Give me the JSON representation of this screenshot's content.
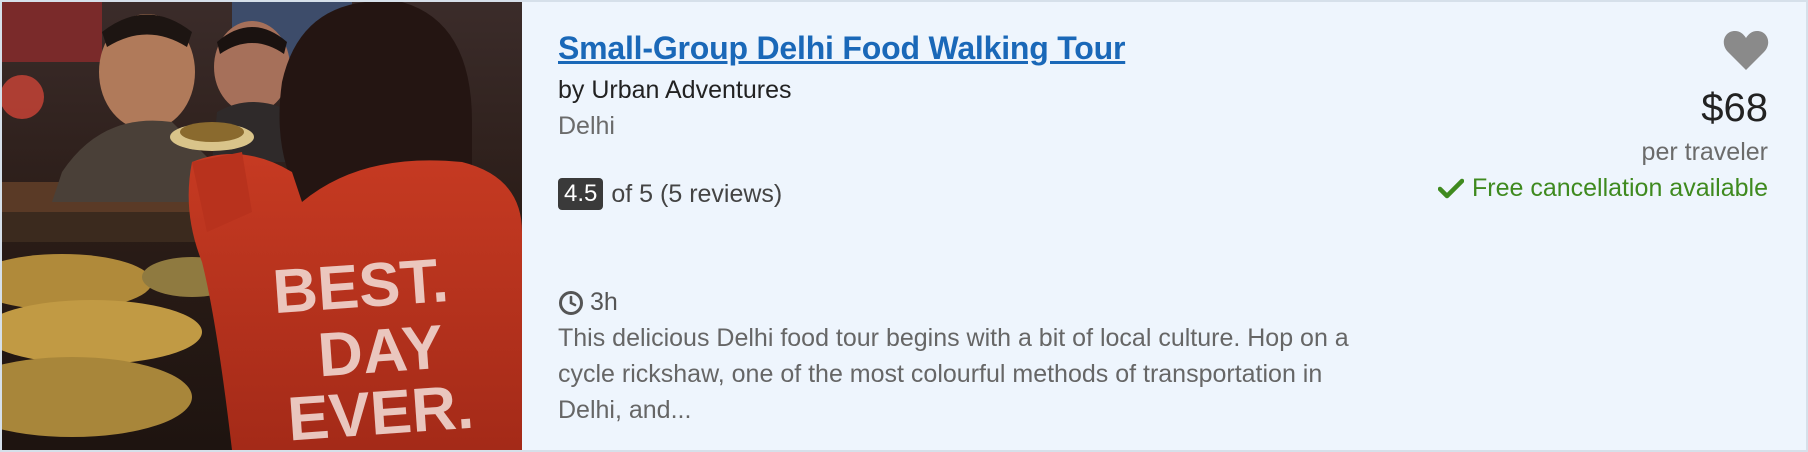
{
  "tour": {
    "title": "Small-Group Delhi Food Walking Tour",
    "operator": "by Urban Adventures",
    "location": "Delhi",
    "rating_value": "4.5",
    "rating_text": "of 5 (5 reviews)",
    "duration": "3h",
    "description": "This delicious Delhi food tour begins with a bit of local culture. Hop on a cycle rickshaw, one of the most colourful methods of transportation in Delhi, and...",
    "price": "$68",
    "price_unit": "per traveler",
    "cancellation": "Free cancellation available",
    "image_jacket_text": [
      "BEST.",
      "DAY",
      "EVER."
    ]
  },
  "icons": {
    "favorite": "heart-icon",
    "duration": "clock-icon",
    "cancellation": "checkmark-icon"
  },
  "colors": {
    "title_link": "#1a68b8",
    "card_background": "#eef5fd",
    "rating_badge": "#3a3a3a",
    "cancellation": "#3f8a1f",
    "heart": "#8a8a8a"
  }
}
